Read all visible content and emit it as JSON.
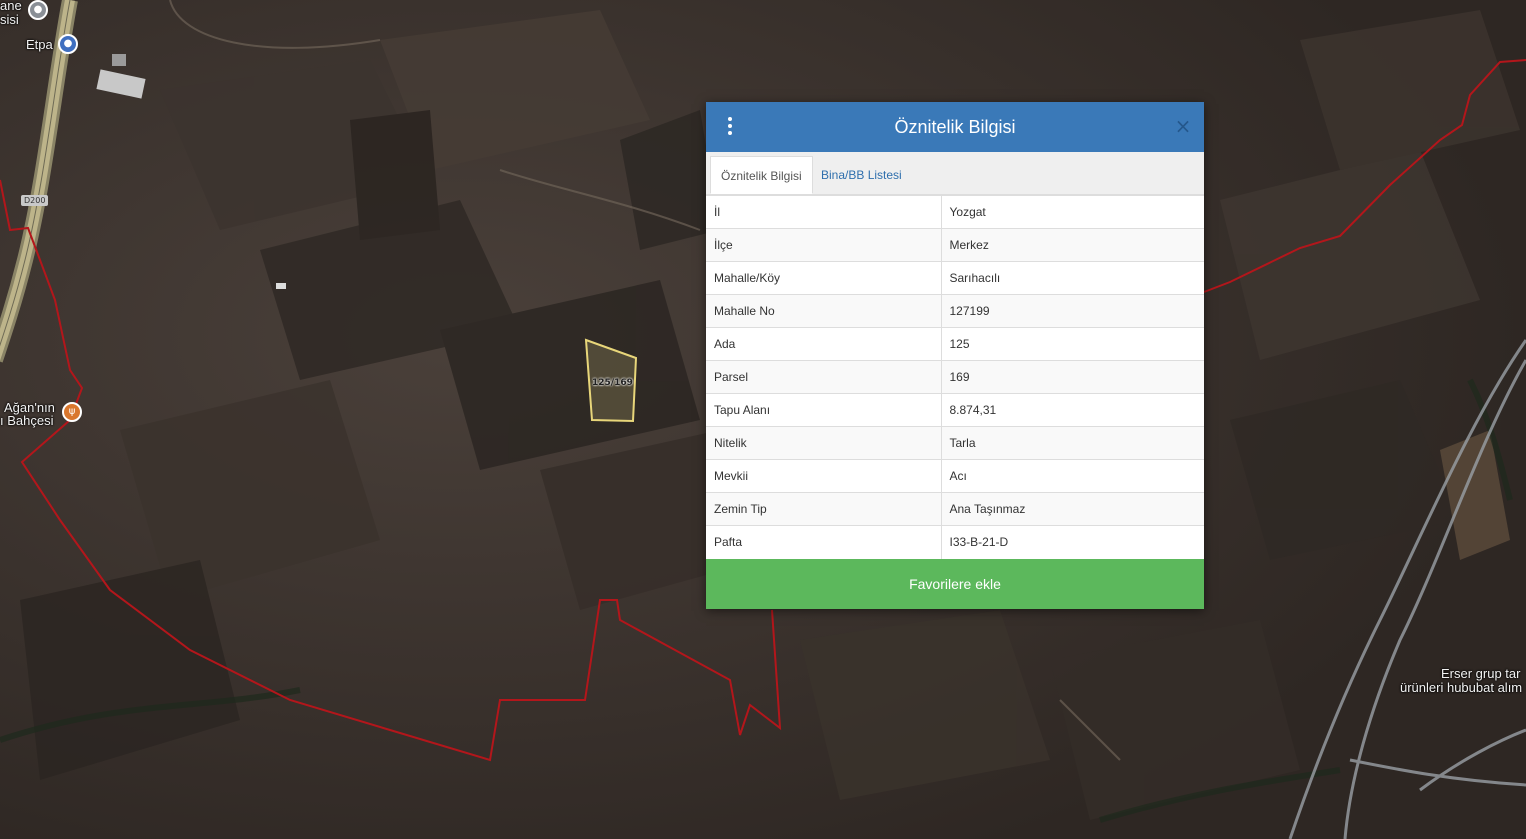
{
  "map": {
    "labels": {
      "top_left_fragment_1": "ane",
      "top_left_fragment_2": "sisi",
      "etpa": "Etpa",
      "road_shield": "D200",
      "restaurant_line1": "Ağan'nın",
      "restaurant_line2": "ı Bahçesi",
      "business_line1": "Erser grup tar",
      "business_line2": "ürünleri hububat alım",
      "parcel": "125/169"
    },
    "colors": {
      "boundary": "#b3161b",
      "parcel_outline": "#e8d67a",
      "road": "#bdb48a",
      "road_light": "#9aa0a6"
    },
    "icons": {
      "etpa": "lock-pin-icon",
      "restaurant": "restaurant-icon",
      "top_left": "location-pin-icon"
    }
  },
  "dialog": {
    "title": "Öznitelik Bilgisi",
    "close_glyph": "×",
    "tabs": [
      {
        "label": "Öznitelik Bilgisi"
      },
      {
        "label": "Bina/BB Listesi"
      }
    ],
    "rows": [
      {
        "key": "İl",
        "value": "Yozgat"
      },
      {
        "key": "İlçe",
        "value": "Merkez"
      },
      {
        "key": "Mahalle/Köy",
        "value": "Sarıhacılı"
      },
      {
        "key": "Mahalle No",
        "value": "127199"
      },
      {
        "key": "Ada",
        "value": "125"
      },
      {
        "key": "Parsel",
        "value": "169"
      },
      {
        "key": "Tapu Alanı",
        "value": "8.874,31"
      },
      {
        "key": "Nitelik",
        "value": "Tarla"
      },
      {
        "key": "Mevkii",
        "value": "Acı"
      },
      {
        "key": "Zemin Tip",
        "value": "Ana Taşınmaz"
      },
      {
        "key": "Pafta",
        "value": "I33-B-21-D"
      }
    ],
    "favorite_button": "Favorilere ekle",
    "header_color": "#3a79b8",
    "button_color": "#5cb85c"
  }
}
